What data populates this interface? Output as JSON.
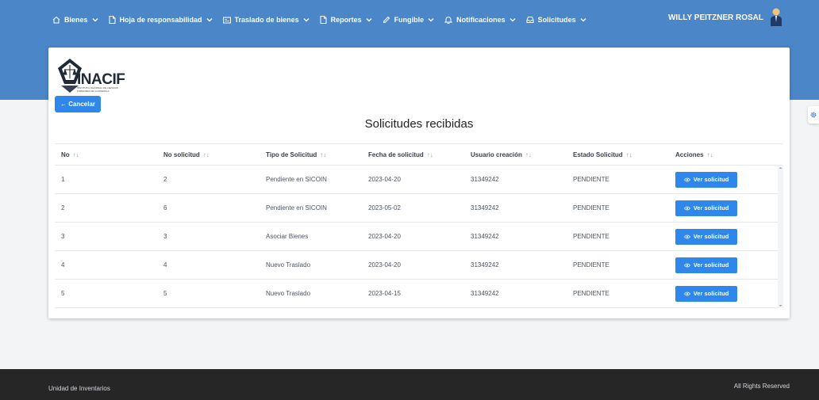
{
  "nav": {
    "items": [
      {
        "label": "Bienes",
        "icon": "home-icon",
        "chevron": true
      },
      {
        "label": "Hoja de responsabilidad",
        "icon": "document-icon",
        "chevron": true
      },
      {
        "label": "Traslado de bienes",
        "icon": "card-icon",
        "chevron": true
      },
      {
        "label": "Reportes",
        "icon": "document-icon",
        "chevron": true
      },
      {
        "label": "Fungible",
        "icon": "pencil-icon",
        "chevron": true
      },
      {
        "label": "Notificaciones",
        "icon": "bell-icon",
        "chevron": true
      },
      {
        "label": "Solicitudes",
        "icon": "inbox-icon",
        "chevron": true
      }
    ],
    "user_name": "WILLY PEITZNER ROSAL"
  },
  "logo": {
    "text": "INACIF",
    "subtext": "INSTITUTO NACIONAL DE CIENCIAS FORENSES DE GUATEMALA"
  },
  "cancel_label": "← Cancelar",
  "page_title": "Solicitudes recibidas",
  "table": {
    "sort_glyph": "↑↓",
    "columns": [
      "No",
      "No solicitud",
      "Tipo de Solicitud",
      "Fecha de solicitud",
      "Usuario creación",
      "Estado Solicitud",
      "Acciones"
    ],
    "rows": [
      {
        "no": "1",
        "no_solicitud": "2",
        "tipo": "Pendiente en SICOIN",
        "fecha": "2023-04-20",
        "usuario": "31349242",
        "estado": "PENDIENTE",
        "accion": "Ver solicitud"
      },
      {
        "no": "2",
        "no_solicitud": "6",
        "tipo": "Pendiente en SICOIN",
        "fecha": "2023-05-02",
        "usuario": "31349242",
        "estado": "PENDIENTE",
        "accion": "Ver solicitud"
      },
      {
        "no": "3",
        "no_solicitud": "3",
        "tipo": "Asociar Bienes",
        "fecha": "2023-04-20",
        "usuario": "31349242",
        "estado": "PENDIENTE",
        "accion": "Ver solicitud"
      },
      {
        "no": "4",
        "no_solicitud": "4",
        "tipo": "Nuevo Traslado",
        "fecha": "2023-04-20",
        "usuario": "31349242",
        "estado": "PENDIENTE",
        "accion": "Ver solicitud"
      },
      {
        "no": "5",
        "no_solicitud": "5",
        "tipo": "Nuevo Traslado",
        "fecha": "2023-04-15",
        "usuario": "31349242",
        "estado": "PENDIENTE",
        "accion": "Ver solicitud"
      }
    ]
  },
  "footer": {
    "left": "Unidad de Inventarios",
    "right": "All Rights Reserved"
  },
  "colors": {
    "header": "#4a86c8",
    "primary_button": "#2f86eb",
    "footer": "#262626"
  }
}
